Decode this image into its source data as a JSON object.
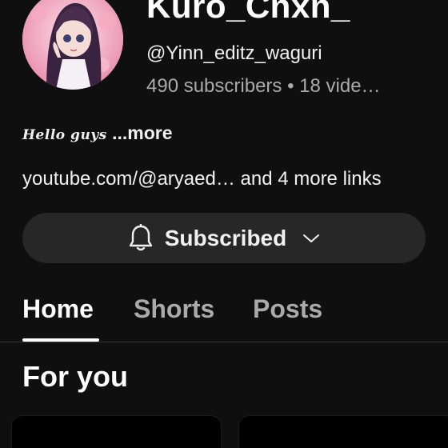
{
  "channel": {
    "name": "Kuro_Cnxn_",
    "handle": "@Yinn_editz_waguri",
    "stats": "490 subscribers • 18 vide…"
  },
  "description": {
    "text": "Hello guys",
    "more_label": "...more"
  },
  "links": {
    "text": "youtube.com/@aryaed… and 4 more links"
  },
  "subscribe_button": {
    "label": "Subscribed",
    "icon": "bell-icon",
    "dropdown_icon": "chevron-down-icon"
  },
  "tabs": [
    {
      "label": "Home",
      "active": true
    },
    {
      "label": "Shorts",
      "active": false
    },
    {
      "label": "Posts",
      "active": false
    }
  ],
  "section": {
    "title": "For you"
  },
  "colors": {
    "background": "#0f0f0f",
    "button_bg": "#272727",
    "primary_text": "#f1f1f1",
    "secondary_text": "#aaaaaa"
  }
}
